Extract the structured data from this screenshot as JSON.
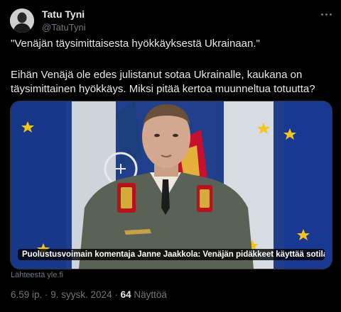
{
  "author": {
    "name": "Tatu Tyni",
    "handle": "@TatuTyni"
  },
  "tweet": {
    "line1": "\"Venäjän täysimittaisesta hyökkäyksestä Ukrainaan.\"",
    "line2": "Eihän Venäjä ole edes julistanut sotaa Ukrainalle, kaukana on",
    "line3": "täysimittainen hyökkäys. Miksi pitää kertoa muunneltua totuutta?"
  },
  "link_card": {
    "caption": "Puolustusvoimain komentaja Janne Jaakkola: Venäjän pidäkkeet käyttää sotilaallista v...",
    "source": "Lähteestä yle.fi"
  },
  "meta": {
    "timestamp": "6.59 ip. · 9. syysk. 2024 · ",
    "views_count": "64",
    "views_label": " Näyttöä"
  },
  "colors": {
    "background": "#000000",
    "text_primary": "#e7e9ea",
    "text_secondary": "#71767b",
    "eu_blue": "#1a3a8a",
    "eu_star": "#f5c518",
    "finland_red": "#c8102e"
  }
}
